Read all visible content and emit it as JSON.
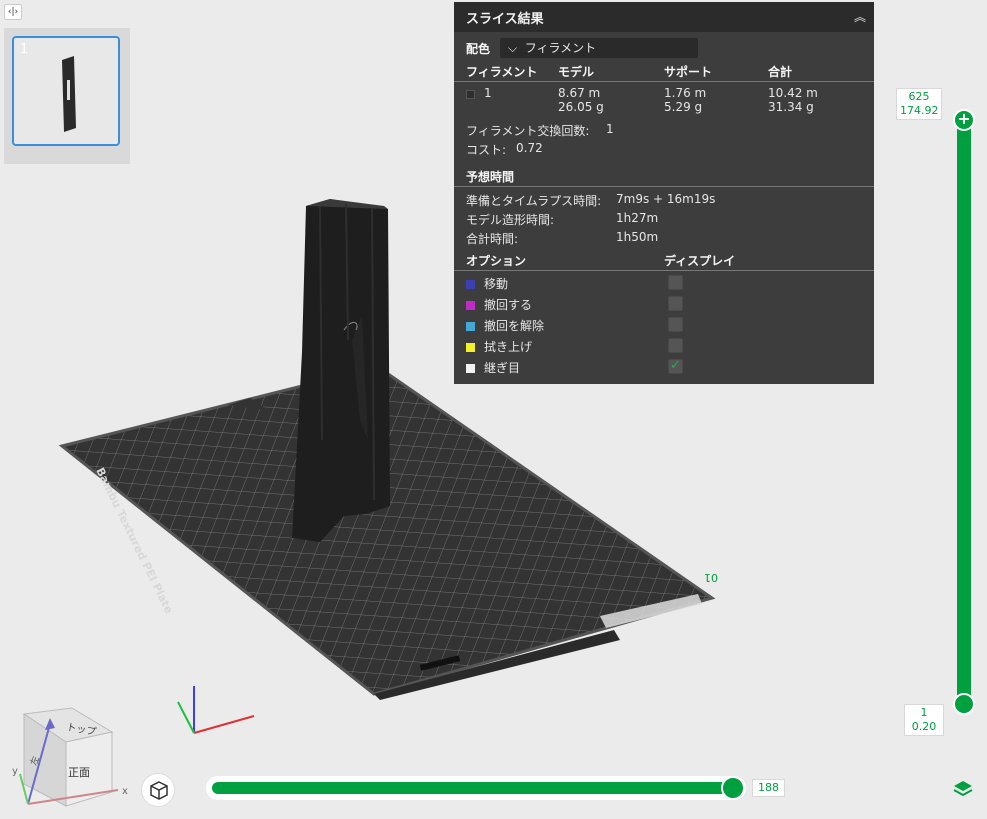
{
  "sidebar_toggle": {
    "icon": "collapse-sidebar-icon",
    "glyph": "‹|›"
  },
  "plate": {
    "number": "1"
  },
  "panel": {
    "title": "スライス結果",
    "color_label": "配色",
    "color_value": "フィラメント",
    "table_headers": [
      "フィラメント",
      "モデル",
      "サポート",
      "合計"
    ],
    "filament_rows": [
      {
        "id": "1",
        "model_len": "8.67 m",
        "model_weight": "26.05 g",
        "support_len": "1.76 m",
        "support_weight": "5.29 g",
        "total_len": "10.42 m",
        "total_weight": "31.34 g",
        "color": "#2e2e2e"
      }
    ],
    "filament_change_label": "フィラメント交換回数:",
    "filament_change_value": "1",
    "cost_label": "コスト:",
    "cost_value": "0.72",
    "estimate_title": "予想時間",
    "prep_label": "準備とタイムラプス時間:",
    "prep_value": "7m9s + 16m19s",
    "model_time_label": "モデル造形時間:",
    "model_time_value": "1h27m",
    "total_time_label": "合計時間:",
    "total_time_value": "1h50m",
    "options_header": "オプション",
    "display_header": "ディスプレイ",
    "options": [
      {
        "label": "移動",
        "color": "#3b3fb0",
        "checked": false
      },
      {
        "label": "撤回する",
        "color": "#c02bc8",
        "checked": false
      },
      {
        "label": "撤回を解除",
        "color": "#46a8d6",
        "checked": false
      },
      {
        "label": "拭き上げ",
        "color": "#f1f02a",
        "checked": false
      },
      {
        "label": "継ぎ目",
        "color": "#f2f2f2",
        "checked": true
      }
    ]
  },
  "layer_slider": {
    "top_layer": "625",
    "top_height": "174.92",
    "bottom_layer": "1",
    "bottom_height": "0.20"
  },
  "move_slider": {
    "value": "188",
    "progress": 0.97
  },
  "bed": {
    "label": "Bambu Textured PEI Plate",
    "origin_label": "01",
    "color": "#3b3b3b"
  },
  "navcube": {
    "top": "トップ",
    "front": "正面",
    "left": "左",
    "x": "x",
    "y": "y"
  },
  "colors": {
    "accent": "#00a040",
    "selection": "#3b8fdc",
    "panel_bg": "#3d3d3d"
  }
}
